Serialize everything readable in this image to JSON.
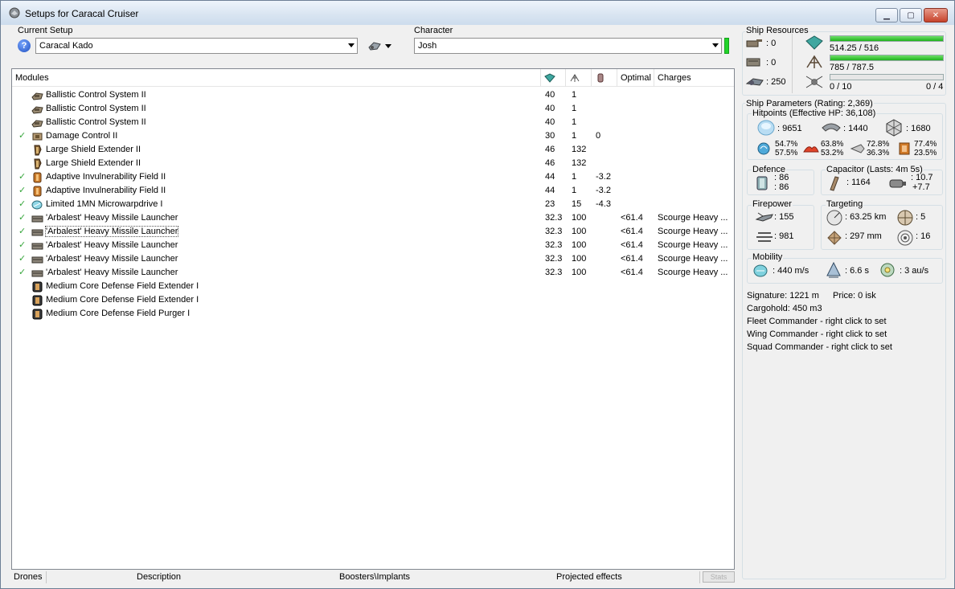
{
  "window": {
    "title": "Setups for Caracal Cruiser"
  },
  "setup": {
    "label": "Current Setup",
    "value": "Caracal Kado"
  },
  "character": {
    "label": "Character",
    "value": "Josh"
  },
  "modules": {
    "columns": [
      "Modules",
      "Optimal",
      "Charges"
    ],
    "rows": [
      {
        "checked": false,
        "name": "Ballistic Control System II",
        "cpu": "40",
        "pg": "1",
        "cap": "",
        "optimal": "",
        "charges": "",
        "icon": "ballistic-control-icon"
      },
      {
        "checked": false,
        "name": "Ballistic Control System II",
        "cpu": "40",
        "pg": "1",
        "cap": "",
        "optimal": "",
        "charges": "",
        "icon": "ballistic-control-icon"
      },
      {
        "checked": false,
        "name": "Ballistic Control System II",
        "cpu": "40",
        "pg": "1",
        "cap": "",
        "optimal": "",
        "charges": "",
        "icon": "ballistic-control-icon"
      },
      {
        "checked": true,
        "name": "Damage Control II",
        "cpu": "30",
        "pg": "1",
        "cap": "0",
        "optimal": "",
        "charges": "",
        "icon": "damage-control-icon"
      },
      {
        "checked": false,
        "name": "Large Shield Extender II",
        "cpu": "46",
        "pg": "132",
        "cap": "",
        "optimal": "",
        "charges": "",
        "icon": "shield-extender-icon"
      },
      {
        "checked": false,
        "name": "Large Shield Extender II",
        "cpu": "46",
        "pg": "132",
        "cap": "",
        "optimal": "",
        "charges": "",
        "icon": "shield-extender-icon"
      },
      {
        "checked": true,
        "name": "Adaptive Invulnerability Field II",
        "cpu": "44",
        "pg": "1",
        "cap": "-3.2",
        "optimal": "",
        "charges": "",
        "icon": "invulnerability-field-icon"
      },
      {
        "checked": true,
        "name": "Adaptive Invulnerability Field II",
        "cpu": "44",
        "pg": "1",
        "cap": "-3.2",
        "optimal": "",
        "charges": "",
        "icon": "invulnerability-field-icon"
      },
      {
        "checked": true,
        "name": "Limited 1MN Microwarpdrive I",
        "cpu": "23",
        "pg": "15",
        "cap": "-4.3",
        "optimal": "",
        "charges": "",
        "icon": "microwarpdrive-icon"
      },
      {
        "checked": true,
        "name": "'Arbalest' Heavy Missile Launcher",
        "cpu": "32.3",
        "pg": "100",
        "cap": "",
        "optimal": "<61.4",
        "charges": "Scourge Heavy ...",
        "icon": "missile-launcher-icon"
      },
      {
        "checked": true,
        "name": "'Arbalest' Heavy Missile Launcher",
        "cpu": "32.3",
        "pg": "100",
        "cap": "",
        "optimal": "<61.4",
        "charges": "Scourge Heavy ...",
        "icon": "missile-launcher-icon"
      },
      {
        "checked": true,
        "name": "'Arbalest' Heavy Missile Launcher",
        "cpu": "32.3",
        "pg": "100",
        "cap": "",
        "optimal": "<61.4",
        "charges": "Scourge Heavy ...",
        "icon": "missile-launcher-icon"
      },
      {
        "checked": true,
        "name": "'Arbalest' Heavy Missile Launcher",
        "cpu": "32.3",
        "pg": "100",
        "cap": "",
        "optimal": "<61.4",
        "charges": "Scourge Heavy ...",
        "icon": "missile-launcher-icon"
      },
      {
        "checked": true,
        "name": "'Arbalest' Heavy Missile Launcher",
        "cpu": "32.3",
        "pg": "100",
        "cap": "",
        "optimal": "<61.4",
        "charges": "Scourge Heavy ...",
        "icon": "missile-launcher-icon"
      },
      {
        "checked": false,
        "name": "Medium Core Defense Field Extender I",
        "cpu": "",
        "pg": "",
        "cap": "",
        "optimal": "",
        "charges": "",
        "icon": "rig-icon"
      },
      {
        "checked": false,
        "name": "Medium Core Defense Field Extender I",
        "cpu": "",
        "pg": "",
        "cap": "",
        "optimal": "",
        "charges": "",
        "icon": "rig-icon"
      },
      {
        "checked": false,
        "name": "Medium Core Defense Field Purger I",
        "cpu": "",
        "pg": "",
        "cap": "",
        "optimal": "",
        "charges": "",
        "icon": "rig-icon"
      }
    ]
  },
  "tabs": {
    "drones": "Drones",
    "description": "Description",
    "boosters": "Boosters\\Implants",
    "projected": "Projected effects",
    "stats": "Stats"
  },
  "resources": {
    "title": "Ship Resources",
    "turret_hardpoints": ": 0",
    "launcher_hardpoints": ": 0",
    "calibration": ": 250",
    "cpu_text": "514.25 / 516",
    "cpu_fraction": 0.9966,
    "pg_text": "785 / 787.5",
    "pg_fraction": 0.9968,
    "drone_bay_text": "0 / 10",
    "drone_bandwidth_text": "0 / 4",
    "drone_fraction": 0.0
  },
  "params": {
    "title": "Ship Parameters (Rating: 2,369)",
    "hitpoints_title": "Hitpoints (Effective HP: 36,108)",
    "shield_hp": ": 9651",
    "armor_hp": ": 1440",
    "structure_hp": ": 1680",
    "res_em": [
      "54.7%",
      "57.5%"
    ],
    "res_thermal": [
      "63.8%",
      "53.2%"
    ],
    "res_kinetic": [
      "72.8%",
      "36.3%"
    ],
    "res_explosive": [
      "77.4%",
      "23.5%"
    ],
    "defence_title": "Defence",
    "defence_a": ": 86",
    "defence_b": ": 86",
    "capacitor_title": "Capacitor (Lasts: 4m 5s)",
    "capacitor_amount": ": 1164",
    "capacitor_a": ": 10.7",
    "capacitor_b": "+7.7",
    "firepower_title": "Firepower",
    "firepower_dps": ": 155",
    "firepower_volley": ": 981",
    "targeting_title": "Targeting",
    "targeting_range": ": 63.25 km",
    "targeting_max": ": 5",
    "targeting_scan": ": 297 mm",
    "targeting_sensor": ": 16",
    "mobility_title": "Mobility",
    "mobility_speed": ": 440 m/s",
    "mobility_align": ": 6.6 s",
    "mobility_warp": ": 3 au/s",
    "signature": "Signature: 1221 m",
    "price": "Price: 0 isk",
    "cargohold": "Cargohold: 450 m3",
    "fleet_commander": "Fleet Commander - right click to set",
    "wing_commander": "Wing Commander - right click to set",
    "squad_commander": "Squad Commander - right click to set"
  }
}
